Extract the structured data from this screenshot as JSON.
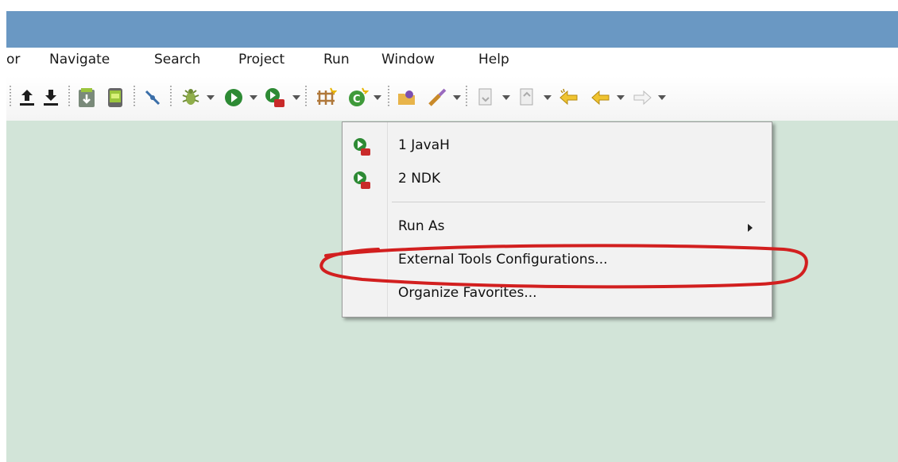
{
  "menubar": {
    "items": [
      "or",
      "Navigate",
      "Search",
      "Project",
      "Run",
      "Window",
      "Help"
    ]
  },
  "toolbar": {
    "icons": [
      "upload-icon",
      "download-icon",
      "sdk-manager-icon",
      "avd-manager-icon",
      "pen-icon",
      "debug-icon",
      "run-icon",
      "external-tools-icon",
      "new-package-icon",
      "new-class-icon",
      "open-folder-icon",
      "brush-icon",
      "next-annotation-icon",
      "prev-annotation-icon",
      "last-edit-icon",
      "back-icon",
      "forward-icon"
    ]
  },
  "dropdown": {
    "items": [
      {
        "label": "1 JavaH",
        "icon": "external-tool-icon"
      },
      {
        "label": "2 NDK",
        "icon": "external-tool-icon"
      },
      {
        "label": "Run As",
        "has_submenu": true
      },
      {
        "label": "External Tools Configurations...",
        "highlighted_by_annotation": true
      },
      {
        "label": "Organize Favorites..."
      }
    ]
  },
  "colors": {
    "titlebar": "#6a98c3",
    "workspace": "#d2e4d8",
    "menu_bg": "#f2f2f2",
    "annotation": "#d21f1f"
  }
}
